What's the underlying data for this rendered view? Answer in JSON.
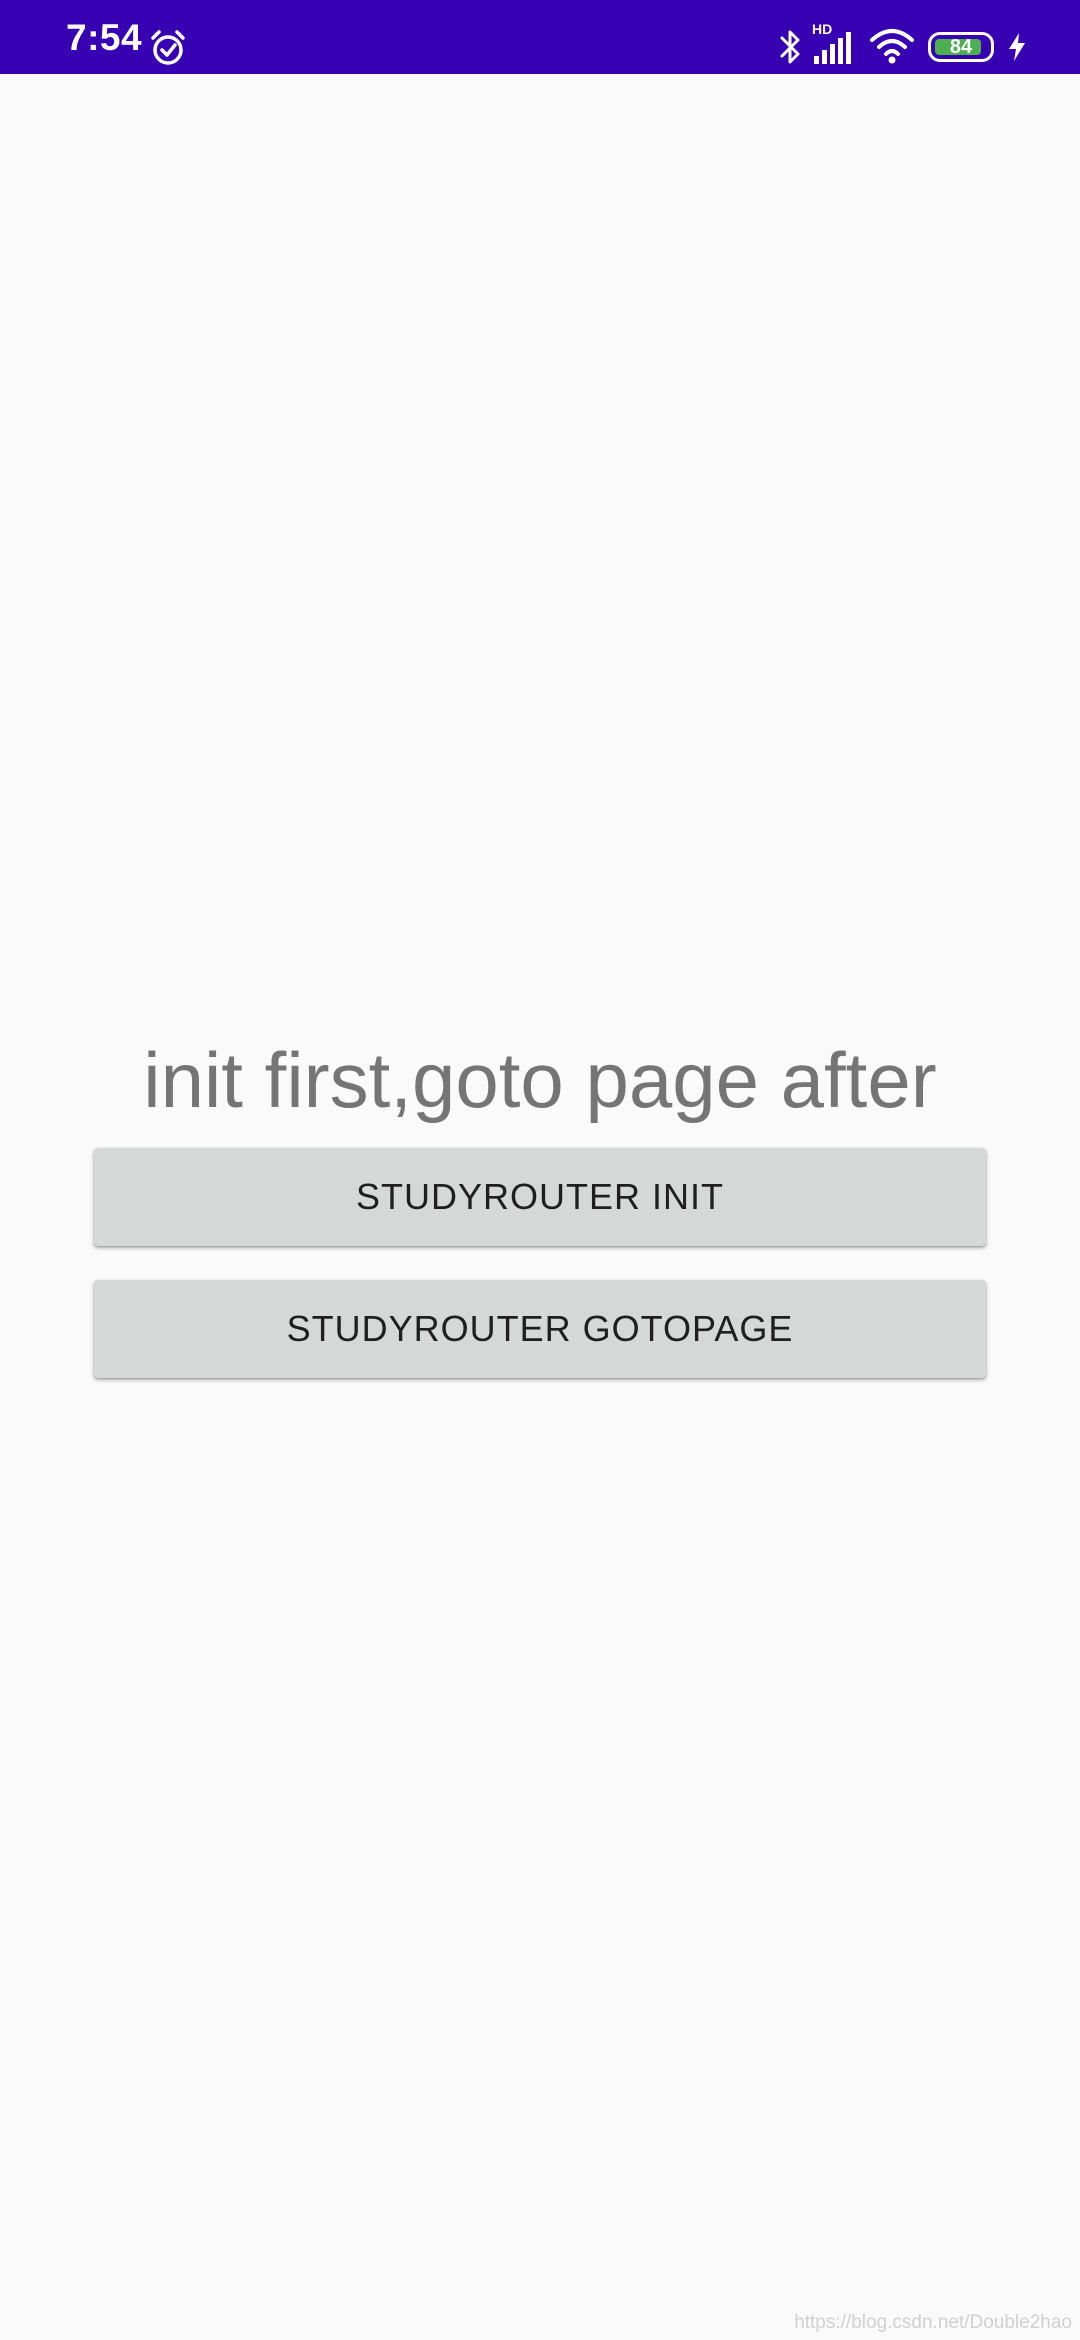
{
  "status_bar": {
    "time": "7:54",
    "network_label": "HD",
    "battery_level": "84",
    "background_color": "#3700b3",
    "battery_color": "#4caf50",
    "icons": [
      "alarm-icon",
      "bluetooth-icon",
      "signal-icon",
      "wifi-icon",
      "battery-icon",
      "charging-bolt-icon"
    ]
  },
  "main": {
    "message": "init first,goto page after",
    "init_button_label": "STUDYROUTER INIT",
    "gotopage_button_label": "STUDYROUTER GOTOPAGE"
  },
  "watermark": "https://blog.csdn.net/Double2hao"
}
